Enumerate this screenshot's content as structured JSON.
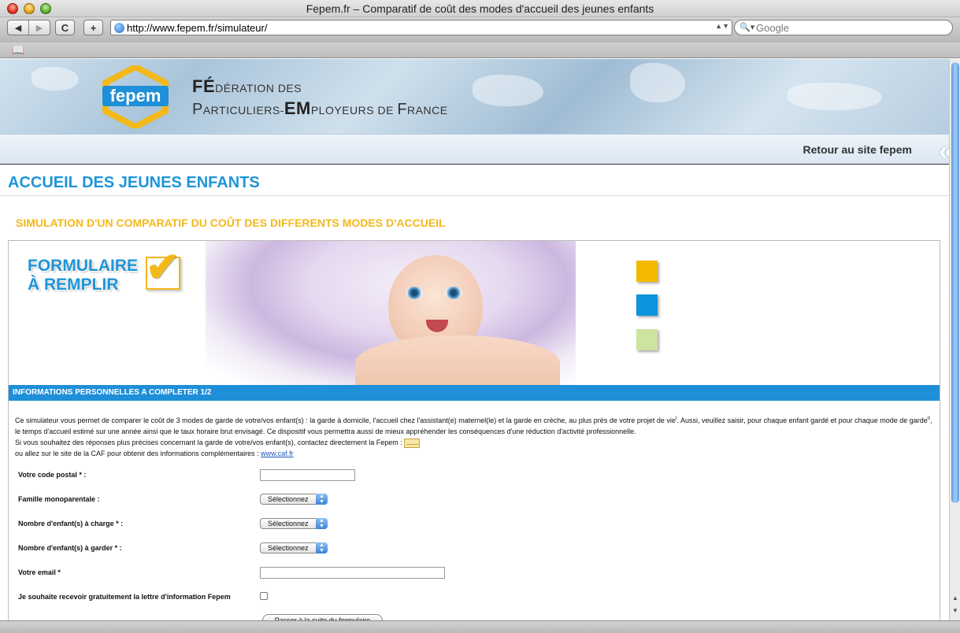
{
  "window": {
    "title": "Fepem.fr – Comparatif de coût des modes d'accueil des jeunes enfants"
  },
  "toolbar": {
    "url": "http://www.fepem.fr/simulateur/",
    "search_placeholder": "Google",
    "back": "◀",
    "forward": "▶",
    "reload": "C",
    "add": "+"
  },
  "header": {
    "logo_text": "fepem",
    "fed_line1_cap": "FÉ",
    "fed_line1_rest": "DÉRATION DES",
    "fed_line2_p": "P",
    "fed_line2_a": "ARTICULIERS-",
    "fed_line2_em": "EM",
    "fed_line2_b": "PLOYEURS DE ",
    "fed_line2_f": "F",
    "fed_line2_c": "RANCE",
    "retour": "Retour au site fepem"
  },
  "page": {
    "title": "ACCUEIL DES JEUNES ENFANTS",
    "subtitle": "SIMULATION D'UN COMPARATIF DU COÛT DES DIFFERENTS MODES D'ACCUEIL",
    "hero_line1": "FORMULAIRE",
    "hero_line2": "À REMPLIR",
    "squares": [
      "#f5b800",
      "#0b95dc",
      "#cde3a0"
    ]
  },
  "form": {
    "section_title": "INFORMATIONS PERSONNELLES A COMPLETER 1/2",
    "intro_1": "Ce simulateur vous permet de comparer le coût de 3 modes de garde de votre/vos enfant(s) : la garde à domicile, l'accueil chez l'assistant(e) maternel(le) et la garde en crèche, au plus près de votre projet de vie",
    "intro_sup1": "I",
    "intro_2": ". Aussi, veuillez saisir, pour chaque enfant gardé et pour chaque mode de garde",
    "intro_sup2": "II",
    "intro_3": ", le temps d'accueil estimé sur une année ainsi que le taux horaire brut envisagé. Ce dispositif vous permettra aussi de mieux appréhender les conséquences d'une réduction d'activité professionnelle.",
    "intro_4": "Si vous souhaitez des réponses plus précises concernant la garde de votre/vos enfant(s), contactez directement la Fepem :",
    "intro_5": "ou allez sur le site de la CAF pour obtenir des informations complémentaires :",
    "caf_link": "www.caf.fr",
    "postal_label": "Votre code postal * :",
    "mono_label": "Famille monoparentale :",
    "charge_label": "Nombre d'enfant(s) à charge * :",
    "garder_label": "Nombre d'enfant(s) à garder * :",
    "email_label": "Votre email *",
    "newsletter_label": "Je souhaite recevoir gratuitement la lettre d'information Fepem",
    "select_value": "Sélectionnez",
    "submit_label": "Passer à la suite du formulaire"
  }
}
